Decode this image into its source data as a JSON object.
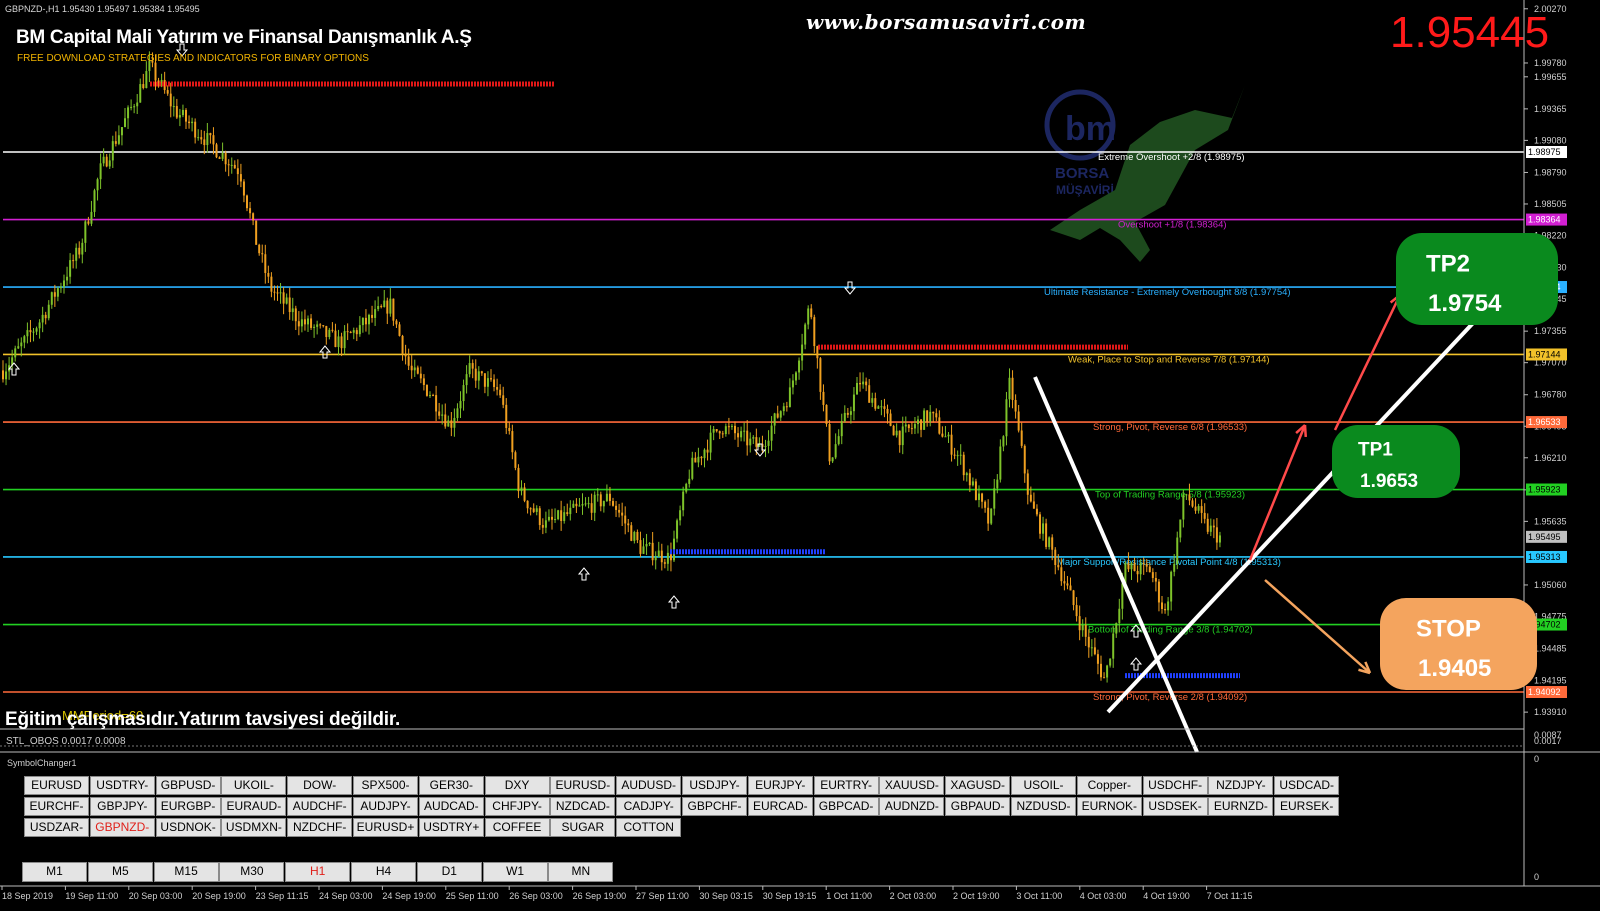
{
  "header": {
    "symbol_info": "GBPNZD-,H1  1.95430 1.95497 1.95384 1.95495",
    "company": "BM Capital Mali Yatırım ve Finansal Danışmanlık A.Ş",
    "tagline": "FREE DOWNLOAD STRATEGIES AND INDICATORS FOR BINARY OPTIONS",
    "website": "www.borsamusaviri.com",
    "current_price": "1.95445",
    "disclaimer": "Eğitim çalışmasıdır.Yatırım tavsiyesi değildir.",
    "indicator_main": "MMPeriod=60",
    "indicator_sub": "STL_OBOS 0.0017 0.0008",
    "subwindow_title": "SymbolChanger1",
    "logo_text": "BORSA MÜŞAVİRİ"
  },
  "colors": {
    "background": "#000000",
    "bull_candle": "#7ec32a",
    "bear_candle": "#f0a020",
    "price_red": "#ff1a1a",
    "tp_green": "#0a8a1e",
    "stop_orange": "#f4a45e"
  },
  "chart_data": {
    "type": "candlestick",
    "symbol": "GBPNZD-",
    "timeframe": "H1",
    "ylim": [
      1.929,
      2.0027
    ],
    "y_ticks": [
      "2.00270",
      "1.99780",
      "1.99655",
      "1.99365",
      "1.99080",
      "1.98790",
      "1.98505",
      "1.98220",
      "1.97930",
      "1.97645",
      "1.97355",
      "1.97070",
      "1.96780",
      "1.96495",
      "1.96210",
      "1.95920",
      "1.95635",
      "1.95060",
      "1.94775",
      "1.94485",
      "1.94195",
      "1.93910"
    ],
    "x_ticks": [
      "18 Sep 2019",
      "19 Sep 11:00",
      "20 Sep 03:00",
      "20 Sep 19:00",
      "23 Sep 11:15",
      "24 Sep 03:00",
      "24 Sep 19:00",
      "25 Sep 11:00",
      "26 Sep 03:00",
      "26 Sep 19:00",
      "27 Sep 11:00",
      "30 Sep 03:15",
      "30 Sep 19:15",
      "1 Oct 11:00",
      "2 Oct 03:00",
      "2 Oct 19:00",
      "3 Oct 11:00",
      "4 Oct 03:00",
      "4 Oct 19:00",
      "7 Oct 11:15"
    ],
    "murrey_levels": [
      {
        "label": "Extreme Overshoot  +2/8  (1.98975)",
        "value": 1.98975,
        "tag": "1.98975",
        "color": "#ffffff"
      },
      {
        "label": "Overshoot  +1/8  (1.98364)",
        "value": 1.98364,
        "tag": "1.98364",
        "color": "#d21fd2"
      },
      {
        "label": "Ultimate Resistance - Extremely Overbought  8/8  (1.97754)",
        "value": 1.97754,
        "tag": "1.97754",
        "color": "#2ab0ff"
      },
      {
        "label": "Weak, Place to Stop and Reverse  7/8  (1.97144)",
        "value": 1.97144,
        "tag": "1.97144",
        "color": "#f2c22a"
      },
      {
        "label": "Strong, Pivot, Reverse  6/8  (1.96533)",
        "value": 1.96533,
        "tag": "1.96533",
        "color": "#ff6a3a"
      },
      {
        "label": "Top of Trading Range  5/8  (1.95923)",
        "value": 1.95923,
        "tag": "1.95923",
        "color": "#22d022"
      },
      {
        "label": "Major Support/Resistance Pivotal Point  4/8  (1.95313)",
        "value": 1.95313,
        "tag": "1.95313",
        "color": "#28c8ff"
      },
      {
        "label": "Bottom of Trading Range  3/8  (1.94702)",
        "value": 1.94702,
        "tag": "1.94702",
        "color": "#22d022"
      },
      {
        "label": "Strong, Pivot, Reverse  2/8  (1.94092)",
        "value": 1.94092,
        "tag": "1.94092",
        "color": "#ff6a3a"
      }
    ],
    "current_tag": "1.95495",
    "sub_axis": [
      "0.0087",
      "0.0017",
      "0",
      "0"
    ],
    "annotations": {
      "tp2": {
        "title": "TP2",
        "value": "1.9754"
      },
      "tp1": {
        "title": "TP1",
        "value": "1.9653"
      },
      "stop": {
        "title": "STOP",
        "value": "1.9405"
      }
    },
    "legend": "none",
    "grid": false
  },
  "symbol_buttons": [
    [
      "EURUSD",
      "USDTRY-",
      "GBPUSD-",
      "UKOIL-",
      "DOW-",
      "SPX500-",
      "GER30-",
      "DXY",
      "EURUSD-",
      "AUDUSD-",
      "USDJPY-",
      "EURJPY-",
      "EURTRY-",
      "XAUUSD-",
      "XAGUSD-",
      "USOIL-",
      "Copper-",
      "USDCHF-",
      "NZDJPY-",
      "USDCAD-"
    ],
    [
      "EURCHF-",
      "GBPJPY-",
      "EURGBP-",
      "EURAUD-",
      "AUDCHF-",
      "AUDJPY-",
      "AUDCAD-",
      "CHFJPY-",
      "NZDCAD-",
      "CADJPY-",
      "GBPCHF-",
      "EURCAD-",
      "GBPCAD-",
      "AUDNZD-",
      "GBPAUD-",
      "NZDUSD-",
      "EURNOK-",
      "USDSEK-",
      "EURNZD-",
      "EURSEK-"
    ],
    [
      "USDZAR-",
      "GBPNZD-",
      "USDNOK-",
      "USDMXN-",
      "NZDCHF-",
      "EURUSD+",
      "USDTRY+",
      "COFFEE",
      "SUGAR",
      "COTTON"
    ]
  ],
  "active_symbol": "GBPNZD-",
  "timeframes": [
    "M1",
    "M5",
    "M15",
    "M30",
    "H1",
    "H4",
    "D1",
    "W1",
    "MN"
  ],
  "active_timeframe": "H1"
}
